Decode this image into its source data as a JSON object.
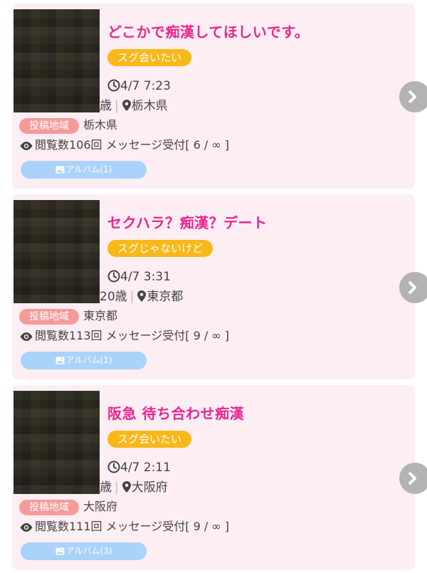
{
  "posts": [
    {
      "title": "どこかで痴漢してほしいです。",
      "tag": "スグ会いたい",
      "time": "4/7 7:23",
      "age": "歳",
      "location": "栃木県",
      "region_label": "投稿地域",
      "region": "栃木県",
      "views": "閲覧数106回 メッセージ受付[ 6 / ∞ ]",
      "album": "アルバム(1)"
    },
    {
      "title": "セクハラ？痴漢？デート",
      "tag": "スグじゃないけど",
      "time": "4/7 3:31",
      "age": "20歳",
      "location": "東京都",
      "region_label": "投稿地域",
      "region": "東京都",
      "views": "閲覧数113回 メッセージ受付[ 9 / ∞ ]",
      "album": "アルバム(1)"
    },
    {
      "title": "阪急 待ち合わせ痴漢",
      "tag": "スグ会いたい",
      "time": "4/7 2:11",
      "age": "歳",
      "location": "大阪府",
      "region_label": "投稿地域",
      "region": "大阪府",
      "views": "閲覧数111回 メッセージ受付[ 9 / ∞ ]",
      "album": "アルバム(3)"
    }
  ],
  "colors": {
    "card_bg": "#fdeef4",
    "title": "#e8268f",
    "tag": "#f9b81a",
    "region_badge": "#f49a9a",
    "album_button": "#a9d3fa",
    "next_button": "#b3b3b3"
  },
  "icons": {
    "clock": "clock-icon",
    "location": "map-pin-icon",
    "views": "eye-icon",
    "album": "image-icon",
    "next": "chevron-right-icon"
  }
}
